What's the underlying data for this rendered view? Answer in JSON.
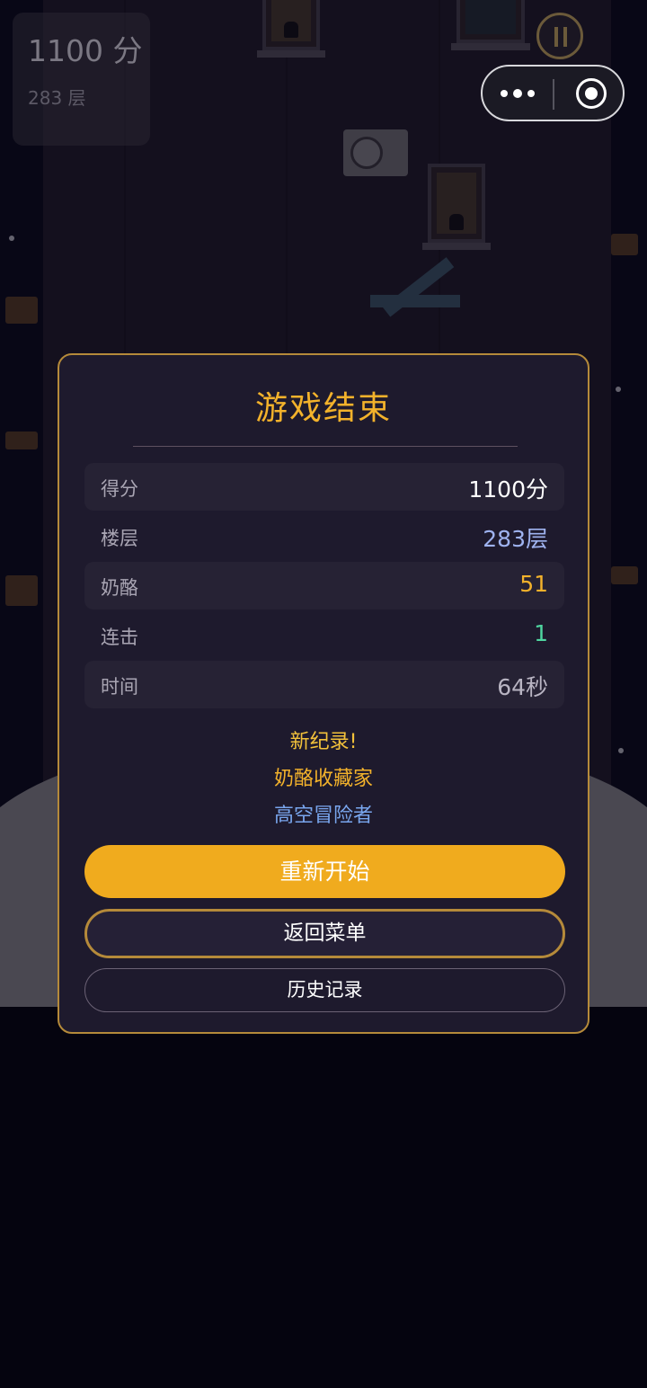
{
  "hud": {
    "score": "1100 分",
    "floor": "283 层"
  },
  "game_over": {
    "title": "游戏结束",
    "stats": [
      {
        "label": "得分",
        "value": "1100分",
        "color": "#ffffff"
      },
      {
        "label": "楼层",
        "value": "283层",
        "color": "#9fb3f0"
      },
      {
        "label": "奶酪",
        "value": "51",
        "color": "#f3b22b"
      },
      {
        "label": "连击",
        "value": "1",
        "color": "#4fd6a0"
      },
      {
        "label": "时间",
        "value": "64秒",
        "color": "#b8b4c2"
      }
    ],
    "achievements": [
      {
        "text": "新纪录!",
        "color": "#f3c23b"
      },
      {
        "text": "奶酪收藏家",
        "color": "#f3b22b"
      },
      {
        "text": "高空冒险者",
        "color": "#79a6ee"
      }
    ],
    "buttons": {
      "restart": "重新开始",
      "menu": "返回菜单",
      "history": "历史记录"
    }
  },
  "icons": {
    "pause": "pause-icon",
    "more": "more-dots-icon",
    "close": "target-close-icon"
  },
  "colors": {
    "accent": "#f0ab1e",
    "modal_bg": "#1e1a2d",
    "modal_border": "#b58a3a"
  }
}
